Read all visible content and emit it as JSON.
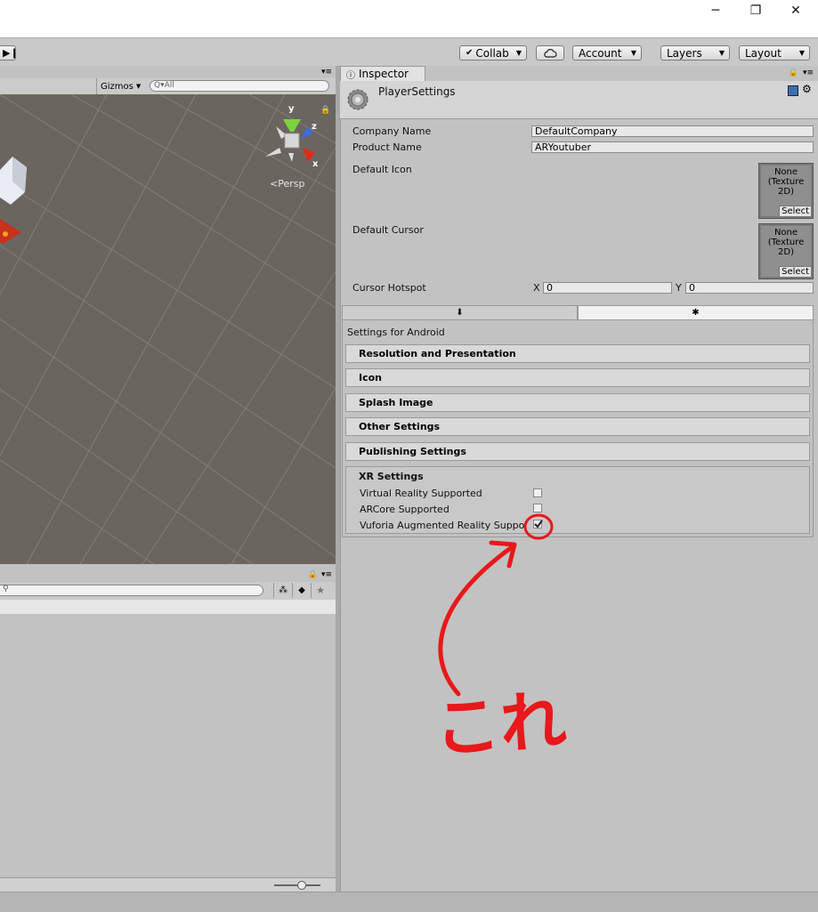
{
  "toolbar": {
    "collab": "Collab",
    "account": "Account",
    "layers": "Layers",
    "layout": "Layout"
  },
  "scene": {
    "gizmos": "Gizmos",
    "search_placeholder": "Q▾All",
    "persp": "Persp",
    "axis_y": "y",
    "axis_z": "z",
    "axis_x": "x"
  },
  "inspector": {
    "tab": "Inspector",
    "title": "PlayerSettings",
    "company_label": "Company Name",
    "company_value": "DefaultCompany",
    "product_label": "Product Name",
    "product_value": "ARYoutuber",
    "default_icon": "Default Icon",
    "default_cursor": "Default Cursor",
    "tex_none": "None",
    "tex_type": "(Texture",
    "tex_2d": "2D)",
    "select": "Select",
    "cursor_hotspot": "Cursor Hotspot",
    "x_label": "X",
    "x_value": "0",
    "y_label": "Y",
    "y_value": "0",
    "settings_for": "Settings for Android",
    "sections": [
      "Resolution and Presentation",
      "Icon",
      "Splash Image",
      "Other Settings",
      "Publishing Settings"
    ],
    "xr_title": "XR Settings",
    "xr_vr": "Virtual Reality Supported",
    "xr_arcore": "ARCore Supported",
    "xr_vuforia": "Vuforia Augmented Reality Suppo"
  },
  "annotation": {
    "text": "これ",
    "color": "#e8181b"
  }
}
